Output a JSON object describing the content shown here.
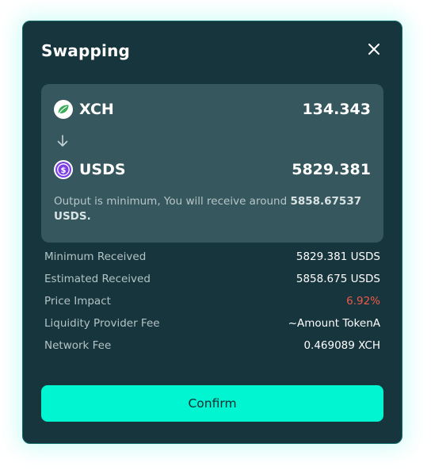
{
  "modal": {
    "title": "Swapping",
    "close_icon": "close-icon"
  },
  "swap": {
    "from": {
      "symbol": "XCH",
      "amount": "134.343",
      "icon": "chia-leaf-icon",
      "icon_color": "#3aac59"
    },
    "direction_icon": "arrow-down-icon",
    "to": {
      "symbol": "USDS",
      "amount": "5829.381",
      "icon": "usds-coin-icon",
      "icon_color": "#7b3fe4"
    },
    "note_text": "Output is minimum, You will receive around ",
    "note_amount": "5858.67537 USDS."
  },
  "details": [
    {
      "label": "Minimum Received",
      "value": "5829.381 USDS"
    },
    {
      "label": "Estimated Received",
      "value": "5858.675 USDS"
    },
    {
      "label": "Price Impact",
      "value": "6.92%"
    },
    {
      "label": "Liquidity Provider Fee",
      "value": "~Amount TokenA"
    },
    {
      "label": "Network Fee",
      "value": "0.469089 XCH"
    }
  ],
  "confirm_label": "Confirm",
  "colors": {
    "accent": "#00f5d0",
    "panel": "#17353d",
    "swap_box": "#35575d",
    "negative": "#ef5a4a"
  }
}
